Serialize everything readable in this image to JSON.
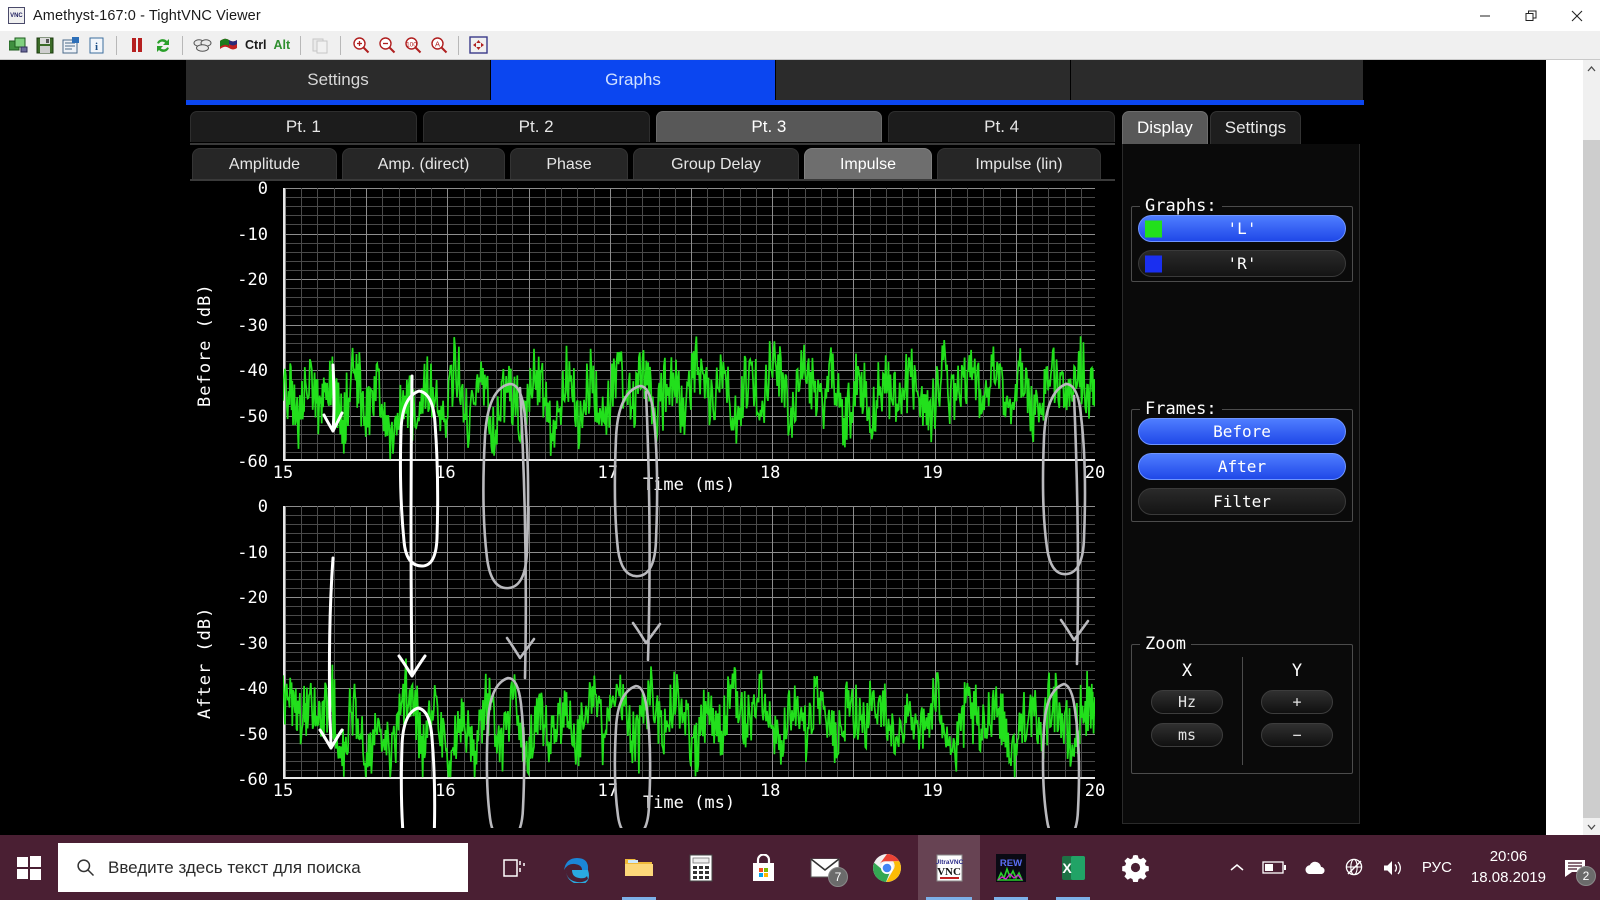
{
  "window": {
    "title": "Amethyst-167:0 - TightVNC Viewer",
    "app_icon": "vnc-icon",
    "controls": {
      "minimize": "minimize-icon",
      "restore": "restore-icon",
      "close": "close-icon"
    }
  },
  "toolbar": {
    "buttons": [
      {
        "name": "new-connection",
        "icon": "new-connection-icon"
      },
      {
        "name": "save-connection",
        "icon": "floppy-disk-icon"
      },
      {
        "name": "connection-options",
        "icon": "options-icon"
      },
      {
        "name": "connection-info",
        "icon": "info-icon"
      },
      {
        "name": "pause-updates",
        "icon": "pause-icon"
      },
      {
        "name": "refresh-screen",
        "icon": "refresh-icon"
      },
      {
        "name": "send-ctrl-alt-del",
        "icon": "keys-icon"
      },
      {
        "name": "send-ctrl-esc",
        "icon": "windows-flag-icon"
      },
      {
        "name": "ctrl-key",
        "label": "Ctrl"
      },
      {
        "name": "alt-key",
        "label": "Alt"
      },
      {
        "name": "clipboard-transfer",
        "icon": "clipboard-icon"
      },
      {
        "name": "zoom-in",
        "icon": "zoom-in-icon"
      },
      {
        "name": "zoom-out",
        "icon": "zoom-out-icon"
      },
      {
        "name": "zoom-100",
        "icon": "zoom-100-icon"
      },
      {
        "name": "zoom-auto",
        "icon": "zoom-auto-icon"
      },
      {
        "name": "full-screen",
        "icon": "fullscreen-icon"
      }
    ]
  },
  "scrollbar": {
    "up": "chevron-up-icon",
    "down": "chevron-down-icon"
  },
  "app": {
    "main_tabs": [
      {
        "label": "Settings",
        "active": false
      },
      {
        "label": "Graphs",
        "active": true
      },
      {
        "label": "",
        "active": false
      },
      {
        "label": "",
        "active": false
      }
    ],
    "point_tabs": [
      {
        "label": "Pt. 1",
        "active": false
      },
      {
        "label": "Pt. 2",
        "active": false
      },
      {
        "label": "Pt. 3",
        "active": true
      },
      {
        "label": "Pt. 4",
        "active": false
      }
    ],
    "graph_tabs": [
      {
        "label": "Amplitude",
        "active": false
      },
      {
        "label": "Amp. (direct)",
        "active": false
      },
      {
        "label": "Phase",
        "active": false
      },
      {
        "label": "Group Delay",
        "active": false
      },
      {
        "label": "Impulse",
        "active": true
      },
      {
        "label": "Impulse (lin)",
        "active": false
      }
    ],
    "side": {
      "tabs": [
        {
          "label": "Display",
          "active": true
        },
        {
          "label": "Settings",
          "active": false
        }
      ],
      "graphs_group": {
        "legend": "Graphs:",
        "items": [
          {
            "label": "'L'",
            "color": "#22e01c",
            "active": true
          },
          {
            "label": "'R'",
            "color": "#1a2ff0",
            "active": false
          }
        ]
      },
      "frames_group": {
        "legend": "Frames:",
        "items": [
          {
            "label": "Before",
            "active": true
          },
          {
            "label": "After",
            "active": true
          },
          {
            "label": "Filter",
            "active": false
          }
        ]
      },
      "zoom_group": {
        "legend": "Zoom",
        "x": {
          "title": "X",
          "buttons": [
            "Hz",
            "ms"
          ]
        },
        "y": {
          "title": "Y",
          "buttons": [
            "+",
            "−"
          ]
        }
      }
    }
  },
  "chart_data": [
    {
      "type": "line",
      "title": "",
      "xlabel": "Time (ms)",
      "ylabel": "Before (dB)",
      "xlim": [
        15,
        20
      ],
      "ylim": [
        -60,
        0
      ],
      "xticks": [
        15,
        16,
        17,
        18,
        19,
        20
      ],
      "yticks": [
        0,
        -10,
        -20,
        -30,
        -40,
        -50,
        -60
      ],
      "grid": true,
      "legend": "none",
      "series": [
        {
          "name": "'L'",
          "color": "#22e01c",
          "x": [
            15.0,
            15.04,
            15.07,
            15.1,
            15.13,
            15.16,
            15.2,
            15.23,
            15.26,
            15.3,
            15.33,
            15.37,
            15.4,
            15.44,
            15.47,
            15.51,
            15.55,
            15.58,
            15.62,
            15.66,
            15.7,
            15.74,
            15.78,
            15.82,
            15.86,
            15.9,
            15.94,
            15.98,
            16.02,
            16.06,
            16.1,
            16.14,
            16.18,
            16.22,
            16.26,
            16.3,
            16.34,
            16.38,
            16.42,
            16.46,
            16.5,
            16.54,
            16.58,
            16.62,
            16.66,
            16.7,
            16.74,
            16.78,
            16.82,
            16.86,
            16.9,
            16.94,
            16.98,
            17.02,
            17.06,
            17.1,
            17.14,
            17.18,
            17.22,
            17.26,
            17.3,
            17.34,
            17.38,
            17.42,
            17.46,
            17.5,
            17.54,
            17.58,
            17.62,
            17.66,
            17.7,
            17.74,
            17.78,
            17.82,
            17.86,
            17.9,
            17.94,
            17.98,
            18.02,
            18.06,
            18.1,
            18.14,
            18.18,
            18.22,
            18.26,
            18.3,
            18.34,
            18.38,
            18.42,
            18.46,
            18.5,
            18.54,
            18.58,
            18.62,
            18.66,
            18.7,
            18.74,
            18.78,
            18.82,
            18.86,
            18.9,
            18.94,
            18.98,
            19.02,
            19.06,
            19.1,
            19.14,
            19.18,
            19.22,
            19.26,
            19.3,
            19.34,
            19.38,
            19.42,
            19.46,
            19.5,
            19.54,
            19.58,
            19.62,
            19.66,
            19.7,
            19.74,
            19.78,
            19.82,
            19.86,
            19.9,
            19.94,
            19.98,
            20.0
          ],
          "y": [
            -44,
            -41,
            -46,
            -50,
            -43,
            -40,
            -44,
            -48,
            -42,
            -39,
            -45,
            -52,
            -44,
            -38,
            -42,
            -49,
            -45,
            -41,
            -47,
            -55,
            -48,
            -42,
            -46,
            -51,
            -44,
            -40,
            -43,
            -48,
            -44,
            -36,
            -41,
            -50,
            -46,
            -40,
            -45,
            -53,
            -47,
            -41,
            -44,
            -49,
            -43,
            -38,
            -42,
            -47,
            -52,
            -45,
            -39,
            -43,
            -50,
            -44,
            -40,
            -45,
            -51,
            -43,
            -37,
            -41,
            -46,
            -42,
            -38,
            -43,
            -48,
            -44,
            -39,
            -42,
            -47,
            -41,
            -36,
            -40,
            -45,
            -42,
            -38,
            -43,
            -49,
            -44,
            -39,
            -42,
            -46,
            -40,
            -36,
            -40,
            -44,
            -48,
            -42,
            -38,
            -41,
            -46,
            -43,
            -39,
            -44,
            -50,
            -45,
            -40,
            -43,
            -48,
            -44,
            -39,
            -42,
            -47,
            -43,
            -38,
            -41,
            -45,
            -49,
            -43,
            -38,
            -42,
            -46,
            -41,
            -37,
            -41,
            -45,
            -42,
            -38,
            -42,
            -47,
            -43,
            -39,
            -43,
            -48,
            -44,
            -40,
            -38,
            -42,
            -46,
            -41,
            -37,
            -40,
            -44,
            -42
          ]
        }
      ]
    },
    {
      "type": "line",
      "title": "",
      "xlabel": "Time (ms)",
      "ylabel": "After (dB)",
      "xlim": [
        15,
        20
      ],
      "ylim": [
        -60,
        0
      ],
      "xticks": [
        15,
        16,
        17,
        18,
        19,
        20
      ],
      "yticks": [
        0,
        -10,
        -20,
        -30,
        -40,
        -50,
        -60
      ],
      "grid": true,
      "legend": "none",
      "series": [
        {
          "name": "'L'",
          "color": "#22e01c",
          "x": [
            15.0,
            15.04,
            15.07,
            15.1,
            15.13,
            15.16,
            15.2,
            15.23,
            15.26,
            15.3,
            15.33,
            15.37,
            15.4,
            15.44,
            15.47,
            15.51,
            15.55,
            15.58,
            15.62,
            15.66,
            15.7,
            15.74,
            15.78,
            15.82,
            15.86,
            15.9,
            15.94,
            15.98,
            16.02,
            16.06,
            16.1,
            16.14,
            16.18,
            16.22,
            16.26,
            16.3,
            16.34,
            16.38,
            16.42,
            16.46,
            16.5,
            16.54,
            16.58,
            16.62,
            16.66,
            16.7,
            16.74,
            16.78,
            16.82,
            16.86,
            16.9,
            16.94,
            16.98,
            17.02,
            17.06,
            17.1,
            17.14,
            17.18,
            17.22,
            17.26,
            17.3,
            17.34,
            17.38,
            17.42,
            17.46,
            17.5,
            17.54,
            17.58,
            17.62,
            17.66,
            17.7,
            17.74,
            17.78,
            17.82,
            17.86,
            17.9,
            17.94,
            17.98,
            18.02,
            18.06,
            18.1,
            18.14,
            18.18,
            18.22,
            18.26,
            18.3,
            18.34,
            18.38,
            18.42,
            18.46,
            18.5,
            18.54,
            18.58,
            18.62,
            18.66,
            18.7,
            18.74,
            18.78,
            18.82,
            18.86,
            18.9,
            18.94,
            18.98,
            19.02,
            19.06,
            19.1,
            19.14,
            19.18,
            19.22,
            19.26,
            19.3,
            19.34,
            19.38,
            19.42,
            19.46,
            19.5,
            19.54,
            19.58,
            19.62,
            19.66,
            19.7,
            19.74,
            19.78,
            19.82,
            19.86,
            19.9,
            19.94,
            19.98,
            20.0
          ],
          "y": [
            -38,
            -43,
            -40,
            -47,
            -42,
            -45,
            -41,
            -48,
            -44,
            -40,
            -46,
            -52,
            -47,
            -43,
            -49,
            -56,
            -50,
            -44,
            -48,
            -54,
            -47,
            -41,
            -38,
            -44,
            -52,
            -46,
            -42,
            -48,
            -57,
            -50,
            -44,
            -47,
            -53,
            -46,
            -41,
            -45,
            -51,
            -44,
            -40,
            -46,
            -55,
            -48,
            -43,
            -47,
            -52,
            -46,
            -41,
            -45,
            -50,
            -44,
            -40,
            -44,
            -49,
            -43,
            -39,
            -43,
            -48,
            -52,
            -45,
            -40,
            -44,
            -49,
            -43,
            -38,
            -42,
            -47,
            -51,
            -45,
            -40,
            -44,
            -48,
            -43,
            -39,
            -43,
            -47,
            -42,
            -38,
            -42,
            -46,
            -50,
            -44,
            -40,
            -44,
            -48,
            -43,
            -39,
            -42,
            -47,
            -51,
            -45,
            -41,
            -44,
            -48,
            -44,
            -40,
            -43,
            -47,
            -52,
            -46,
            -42,
            -45,
            -49,
            -44,
            -40,
            -43,
            -48,
            -53,
            -46,
            -42,
            -45,
            -50,
            -44,
            -40,
            -44,
            -49,
            -54,
            -47,
            -42,
            -45,
            -50,
            -44,
            -40,
            -43,
            -48,
            -52,
            -46,
            -41,
            -44,
            -42
          ]
        }
      ]
    }
  ],
  "taskbar": {
    "start": "windows-logo-icon",
    "search_placeholder": "Введите здесь текст для поиска",
    "search_icon": "search-icon",
    "items": [
      {
        "name": "task-view",
        "icon": "task-view-icon"
      },
      {
        "name": "edge",
        "icon": "edge-icon"
      },
      {
        "name": "file-explorer",
        "icon": "folder-icon"
      },
      {
        "name": "calculator",
        "icon": "calculator-icon"
      },
      {
        "name": "microsoft-store",
        "icon": "store-icon"
      },
      {
        "name": "mail",
        "icon": "mail-icon",
        "badge": "7"
      },
      {
        "name": "chrome",
        "icon": "chrome-icon"
      },
      {
        "name": "tightvnc-viewer",
        "icon": "vnc-icon"
      },
      {
        "name": "rew",
        "icon": "rew-icon"
      },
      {
        "name": "excel",
        "icon": "excel-icon"
      },
      {
        "name": "settings",
        "icon": "gear-icon"
      }
    ],
    "tray": {
      "overflow": "chevron-up-icon",
      "battery": "battery-icon",
      "onedrive": "cloud-icon",
      "network": "globe-no-internet-icon",
      "volume": "speaker-icon",
      "language": "РУС",
      "time": "20:06",
      "date": "18.08.2019",
      "notifications": "notification-icon",
      "notifications_badge": "2"
    }
  }
}
